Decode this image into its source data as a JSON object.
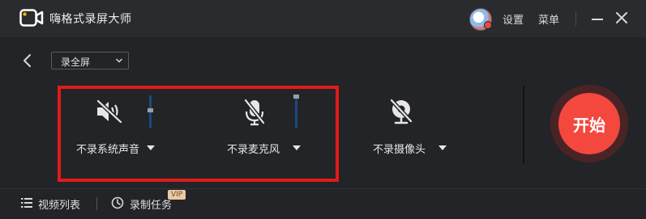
{
  "app": {
    "title": "嗨格式录屏大师"
  },
  "titlebar": {
    "settings_label": "设置",
    "menu_label": "菜单"
  },
  "toolbar": {
    "mode_selected": "录全屏"
  },
  "controls": {
    "audio": {
      "label": "不录系统声音",
      "icon": "speaker-muted-icon",
      "volume_level": 0.7
    },
    "mic": {
      "label": "不录麦克风",
      "icon": "mic-muted-icon",
      "volume_level": 1.0
    },
    "camera": {
      "label": "不录摄像头",
      "icon": "camera-off-icon"
    }
  },
  "start": {
    "label": "开始"
  },
  "bottombar": {
    "video_list_label": "视频列表",
    "task_label": "录制任务",
    "vip_badge": "VIP"
  },
  "colors": {
    "accent": "#f4483f",
    "highlight": "#e01b1b",
    "slider_track": "#1a4a80"
  }
}
